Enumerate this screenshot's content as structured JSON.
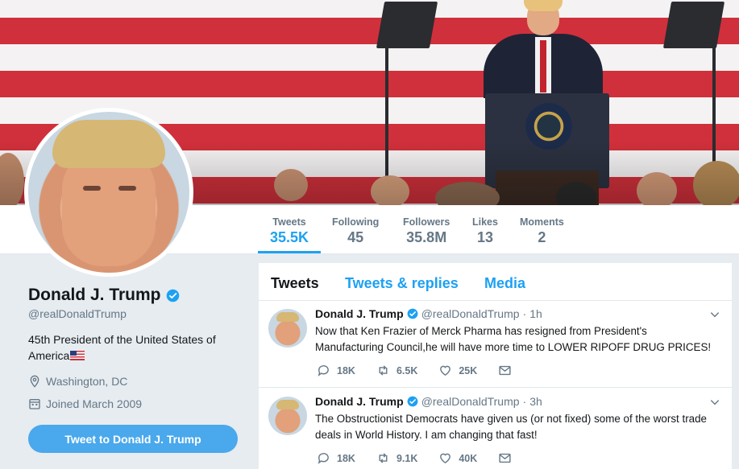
{
  "stats": [
    {
      "label": "Tweets",
      "value": "35.5K",
      "active": true
    },
    {
      "label": "Following",
      "value": "45",
      "active": false
    },
    {
      "label": "Followers",
      "value": "35.8M",
      "active": false
    },
    {
      "label": "Likes",
      "value": "13",
      "active": false
    },
    {
      "label": "Moments",
      "value": "2",
      "active": false
    }
  ],
  "profile": {
    "name": "Donald J. Trump",
    "handle": "@realDonaldTrump",
    "bio": "45th President of the United States of America",
    "location": "Washington, DC",
    "joined": "Joined March 2009",
    "tweet_to_label": "Tweet to Donald J. Trump",
    "verified_icon": "verified-badge-icon"
  },
  "tabs": [
    "Tweets",
    "Tweets & replies",
    "Media"
  ],
  "tweets": [
    {
      "author": "Donald J. Trump",
      "handle": "@realDonaldTrump",
      "time": "1h",
      "text": "Now that Ken Frazier of Merck Pharma has resigned from President's Manufacturing Council,he will have more time to LOWER RIPOFF DRUG PRICES!",
      "replies": "18K",
      "retweets": "6.5K",
      "likes": "25K"
    },
    {
      "author": "Donald J. Trump",
      "handle": "@realDonaldTrump",
      "time": "3h",
      "text": "The Obstructionist Democrats have given us (or not fixed) some of the worst trade deals in World History. I am changing that fast!",
      "replies": "18K",
      "retweets": "9.1K",
      "likes": "40K"
    }
  ],
  "colors": {
    "accent": "#1da1f2",
    "background": "#e6ecf0",
    "muted": "#657786",
    "button": "#4aa8ec"
  }
}
